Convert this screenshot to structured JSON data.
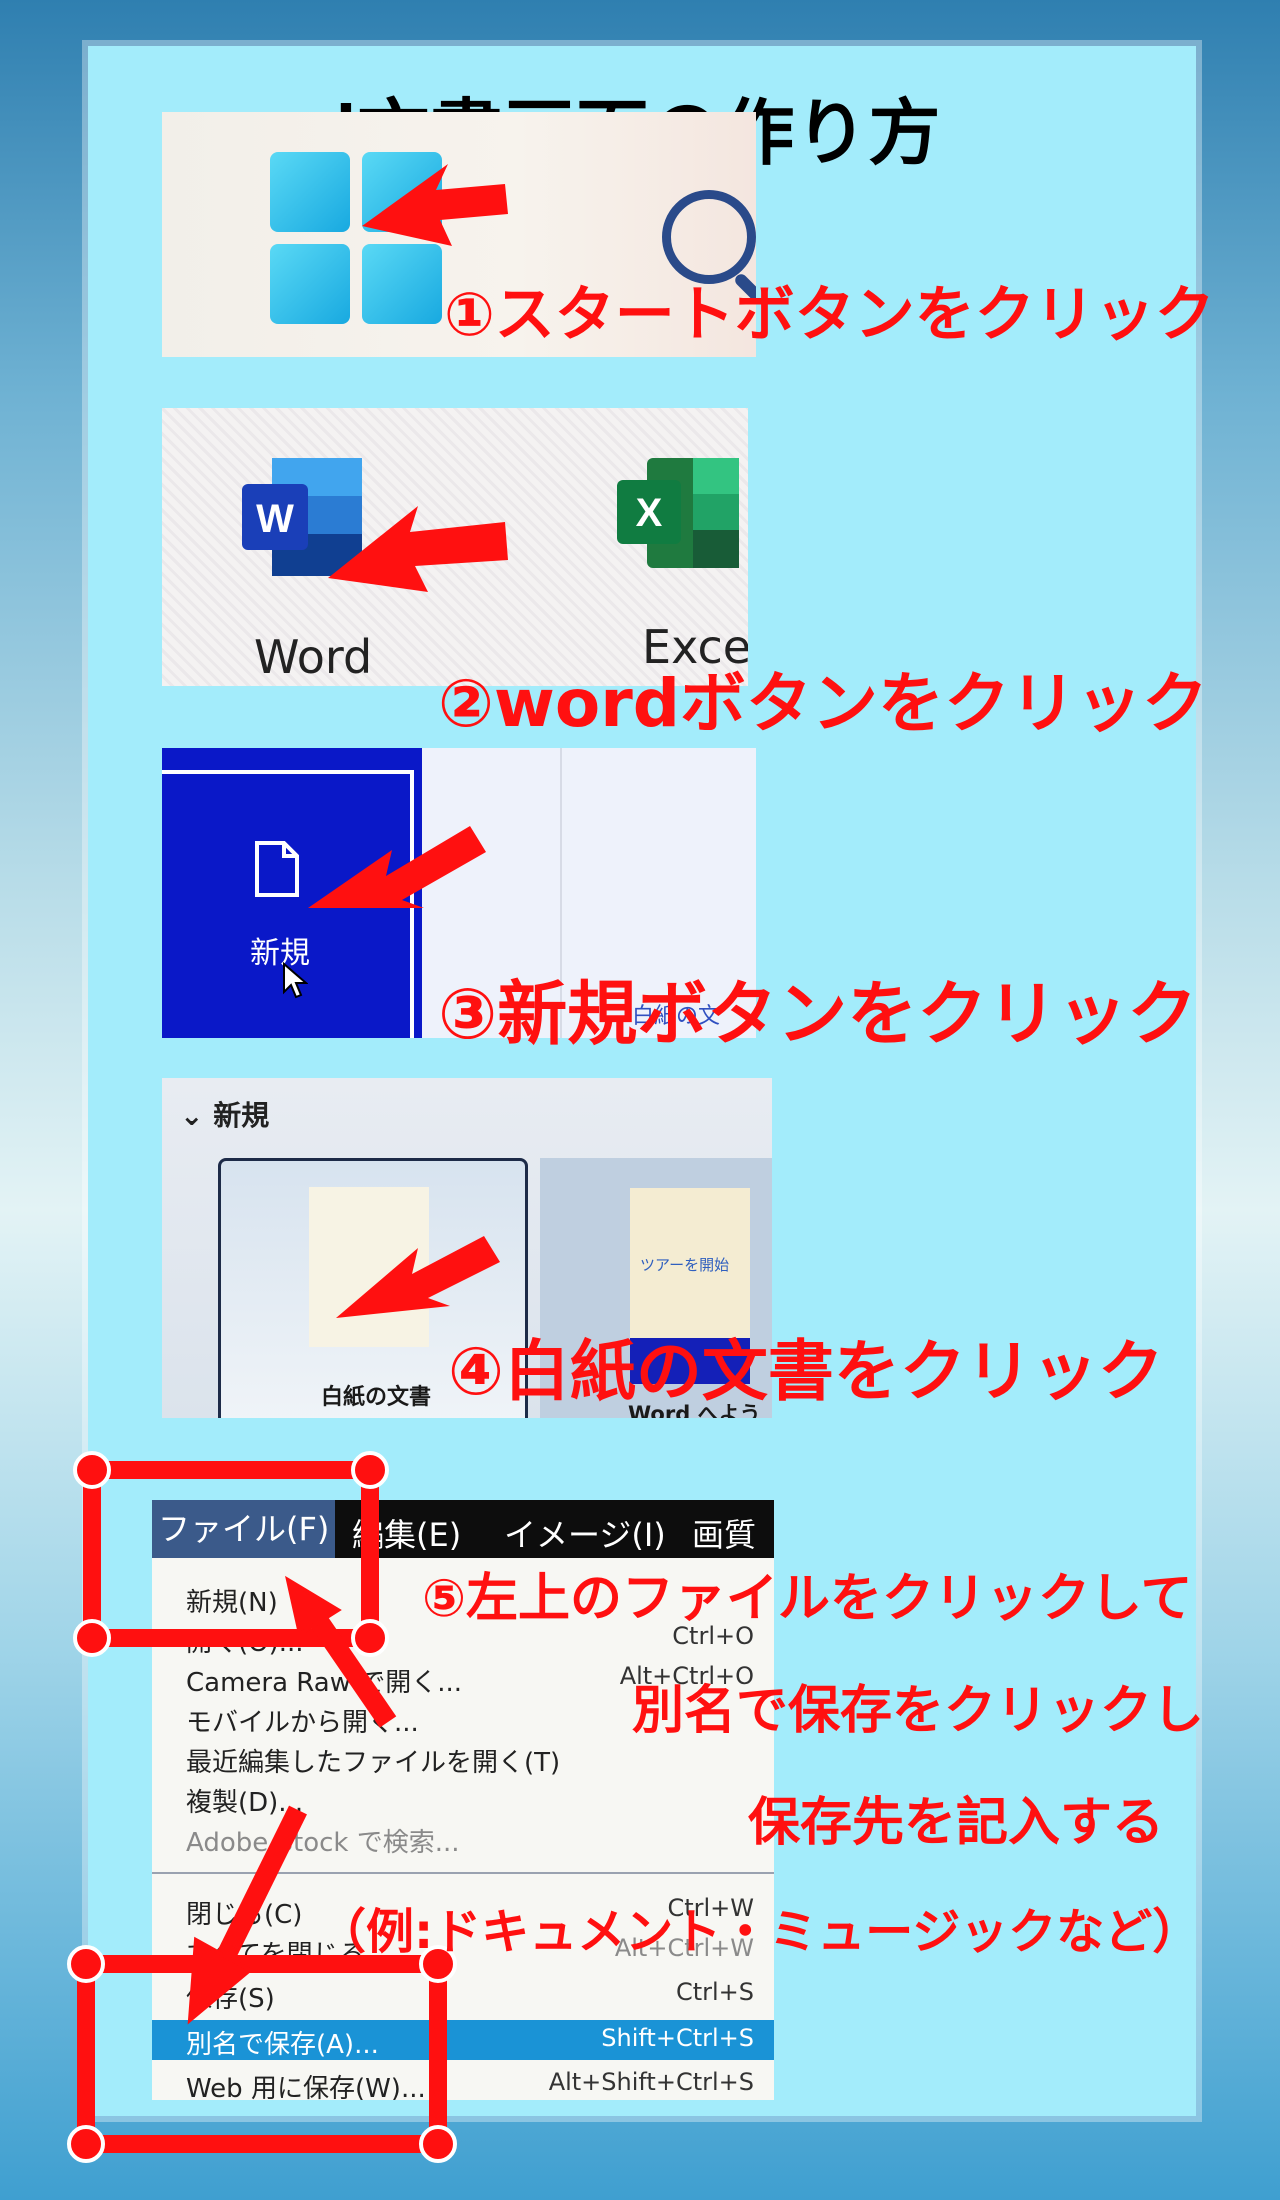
{
  "title": "word文書画面の作り方",
  "steps": [
    {
      "label": "①スタートボタンをクリック"
    },
    {
      "label": "②wordボタンをクリック"
    },
    {
      "label": "③新規ボタンをクリック"
    },
    {
      "label": "④白紙の文書をクリック"
    },
    {
      "lines": [
        "⑤左上のファイルをクリックして",
        "別名で保存をクリックし",
        "保存先を記入する",
        "（例:ドキュメント・ミュージックなど）"
      ]
    }
  ],
  "shot2": {
    "word_label": "Word",
    "excel_label": "Excel",
    "word_letter": "W",
    "excel_letter": "X"
  },
  "shot3": {
    "new_label": "新規",
    "side_text": "白紙の文"
  },
  "shot4": {
    "section": "新規",
    "blank_doc": "白紙の文書",
    "tour": "ツアーを開始",
    "welcome": "Word へようこそ"
  },
  "shot5": {
    "menubar": [
      "ファイル(F)",
      "編集(E)",
      "イメージ(I)",
      "画質"
    ],
    "items": [
      {
        "label": "新規(N)",
        "shortcut": ""
      },
      {
        "label": "開く(O)...",
        "shortcut": "Ctrl+O"
      },
      {
        "label": "Camera Raw で開く...",
        "shortcut": "Alt+Ctrl+O"
      },
      {
        "label": "モバイルから開く...",
        "shortcut": ""
      },
      {
        "label": "最近編集したファイルを開く(T)",
        "shortcut": ""
      },
      {
        "label": "複製(D)...",
        "shortcut": ""
      },
      {
        "label": "Adobe Stock で検索...",
        "shortcut": ""
      },
      {
        "label": "閉じる(C)",
        "shortcut": "Ctrl+W"
      },
      {
        "label": "すべてを閉じる",
        "shortcut": "Alt+Ctrl+W"
      },
      {
        "label": "保存(S)",
        "shortcut": "Ctrl+S"
      },
      {
        "label": "別名で保存(A)...",
        "shortcut": "Shift+Ctrl+S"
      },
      {
        "label": "Web 用に保存(W)...",
        "shortcut": "Alt+Shift+Ctrl+S"
      }
    ]
  },
  "colors": {
    "accent_red": "#ff1010",
    "panel": "#a3ecfb",
    "word_blue": "#1a3fb8",
    "excel_green": "#1f7a3f"
  }
}
